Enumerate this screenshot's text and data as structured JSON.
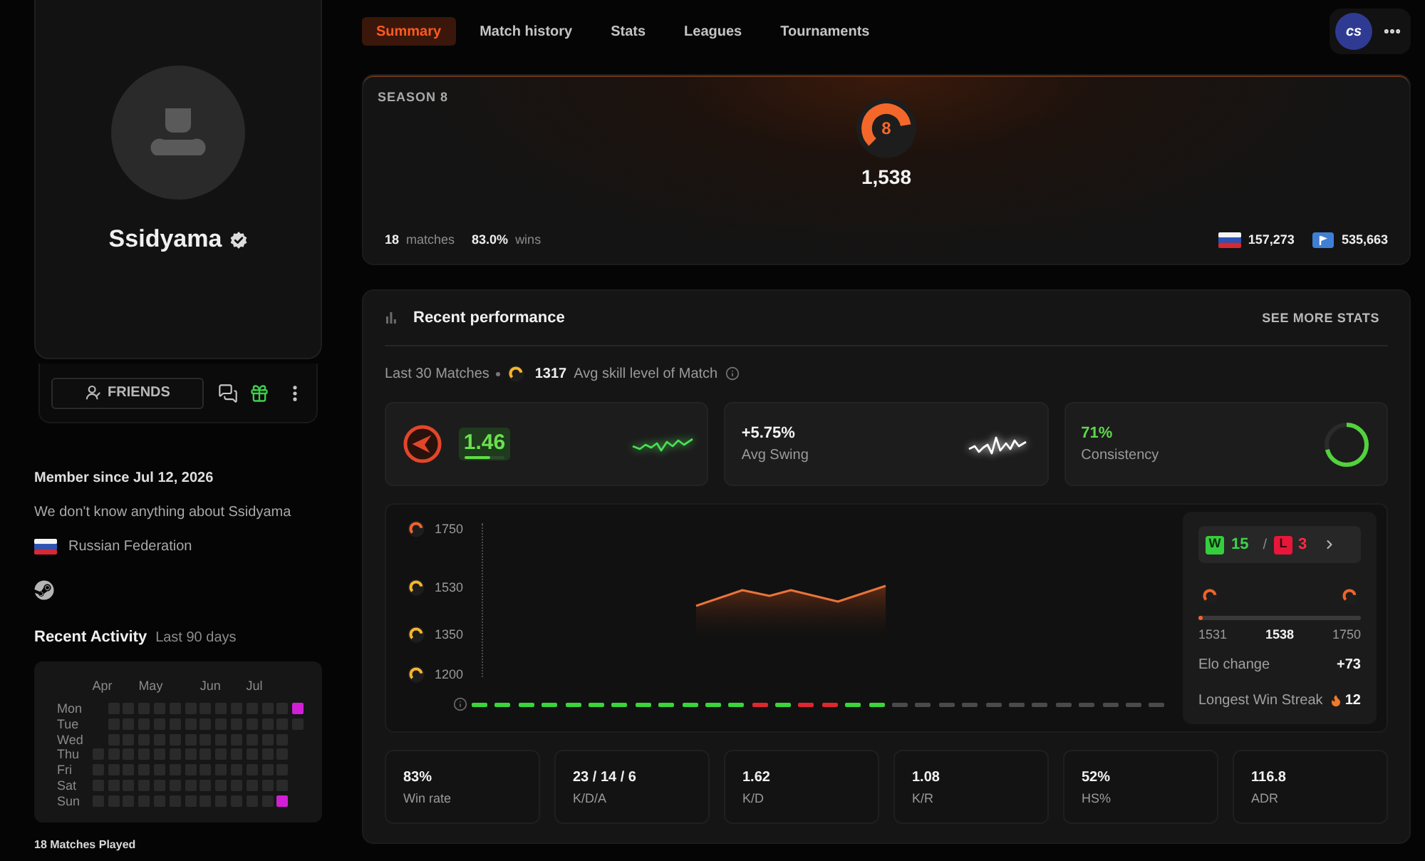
{
  "profile": {
    "name": "Ssidyama",
    "verified": true,
    "friends_button": "FRIENDS"
  },
  "about": {
    "member_since": "Member since Jul 12, 2026",
    "bio": "We don't know anything about Ssidyama",
    "country": "Russian Federation"
  },
  "recent_activity": {
    "title": "Recent Activity",
    "period": "Last 90 days",
    "days": [
      "Mon",
      "Tue",
      "Wed",
      "Thu",
      "Fri",
      "Sat",
      "Sun"
    ],
    "weeks": [
      {
        "kind": "tail",
        "month": "Apr",
        "cells": [
          {
            "played": false
          },
          {
            "played": false
          },
          {
            "played": false
          },
          {
            "played": false
          }
        ]
      },
      {
        "kind": "full",
        "cells": [
          {
            "played": false
          },
          {
            "played": false
          },
          {
            "played": false
          },
          {
            "played": false
          },
          {
            "played": false
          },
          {
            "played": false
          },
          {
            "played": false
          }
        ]
      },
      {
        "kind": "full",
        "cells": [
          {
            "played": false
          },
          {
            "played": false
          },
          {
            "played": false
          },
          {
            "played": false
          },
          {
            "played": false
          },
          {
            "played": false
          },
          {
            "played": false
          }
        ]
      },
      {
        "kind": "full",
        "month": "May",
        "cells": [
          {
            "played": false
          },
          {
            "played": false
          },
          {
            "played": false
          },
          {
            "played": false
          },
          {
            "played": false
          },
          {
            "played": false
          },
          {
            "played": false
          }
        ]
      },
      {
        "kind": "full",
        "cells": [
          {
            "played": false
          },
          {
            "played": false
          },
          {
            "played": false
          },
          {
            "played": false
          },
          {
            "played": false
          },
          {
            "played": false
          },
          {
            "played": false
          }
        ]
      },
      {
        "kind": "full",
        "cells": [
          {
            "played": false
          },
          {
            "played": false
          },
          {
            "played": false
          },
          {
            "played": false
          },
          {
            "played": false
          },
          {
            "played": false
          },
          {
            "played": false
          }
        ]
      },
      {
        "kind": "full",
        "cells": [
          {
            "played": false
          },
          {
            "played": false
          },
          {
            "played": false
          },
          {
            "played": false
          },
          {
            "played": false
          },
          {
            "played": false
          },
          {
            "played": false
          }
        ]
      },
      {
        "kind": "full",
        "month": "Jun",
        "cells": [
          {
            "played": false
          },
          {
            "played": false
          },
          {
            "played": false
          },
          {
            "played": false
          },
          {
            "played": false
          },
          {
            "played": false
          },
          {
            "played": false
          }
        ]
      },
      {
        "kind": "full",
        "cells": [
          {
            "played": false
          },
          {
            "played": false
          },
          {
            "played": false
          },
          {
            "played": false
          },
          {
            "played": false
          },
          {
            "played": false
          },
          {
            "played": false
          }
        ]
      },
      {
        "kind": "full",
        "cells": [
          {
            "played": false
          },
          {
            "played": false
          },
          {
            "played": false
          },
          {
            "played": false
          },
          {
            "played": false
          },
          {
            "played": false
          },
          {
            "played": false
          }
        ]
      },
      {
        "kind": "full",
        "month": "Jul",
        "cells": [
          {
            "played": false
          },
          {
            "played": false
          },
          {
            "played": false
          },
          {
            "played": false
          },
          {
            "played": false
          },
          {
            "played": false
          },
          {
            "played": false
          }
        ]
      },
      {
        "kind": "full",
        "cells": [
          {
            "played": false
          },
          {
            "played": false
          },
          {
            "played": false
          },
          {
            "played": false
          },
          {
            "played": false
          },
          {
            "played": false
          },
          {
            "played": false
          }
        ]
      },
      {
        "kind": "full",
        "cells": [
          {
            "played": false
          },
          {
            "played": false
          },
          {
            "played": false
          },
          {
            "played": false
          },
          {
            "played": false
          },
          {
            "played": false
          },
          {
            "played": true
          }
        ]
      },
      {
        "kind": "head",
        "cells": [
          {
            "played": true
          },
          {
            "played": false
          }
        ]
      }
    ],
    "footer": "18 Matches Played"
  },
  "tabs": [
    {
      "label": "Summary",
      "selected": true
    },
    {
      "label": "Match history",
      "selected": false
    },
    {
      "label": "Stats",
      "selected": false
    },
    {
      "label": "Leagues",
      "selected": false
    },
    {
      "label": "Tournaments",
      "selected": false
    }
  ],
  "game_badge": "cs",
  "season": {
    "title": "SEASON 8",
    "skill_level": "8",
    "elo": "1,538",
    "matches": "18",
    "matches_label": "matches",
    "wins": "83.0%",
    "wins_label": "wins",
    "country_rank": "157,273",
    "region_rank": "535,663"
  },
  "performance": {
    "title": "Recent performance",
    "link": "SEE MORE STATS",
    "scope": "Last 30 Matches",
    "avg_skill": "1317",
    "avg_skill_label": "Avg skill level of Match",
    "cards": [
      {
        "kind": "rating",
        "value": "1.46",
        "level": 0.65
      },
      {
        "kind": "swing",
        "value": "+5.75%",
        "label": "Avg Swing"
      },
      {
        "kind": "consistency",
        "value": "71%",
        "label": "Consistency",
        "level": 0.71
      }
    ],
    "elo_graph": {
      "y_labels": [
        {
          "label": "1750",
          "color": "#f0642a"
        },
        {
          "label": "1530",
          "color": "#f5b52e"
        },
        {
          "label": "1350",
          "color": "#f5b52e"
        },
        {
          "label": "1200",
          "color": "#f5b52e"
        }
      ]
    },
    "results": [
      {
        "kind": "win"
      },
      {
        "kind": "win"
      },
      {
        "kind": "win"
      },
      {
        "kind": "win"
      },
      {
        "kind": "win"
      },
      {
        "kind": "win"
      },
      {
        "kind": "win"
      },
      {
        "kind": "win"
      },
      {
        "kind": "win"
      },
      {
        "kind": "win"
      },
      {
        "kind": "win"
      },
      {
        "kind": "win"
      },
      {
        "kind": "loss"
      },
      {
        "kind": "win"
      },
      {
        "kind": "loss"
      },
      {
        "kind": "loss"
      },
      {
        "kind": "win"
      },
      {
        "kind": "win"
      },
      {
        "kind": "none"
      },
      {
        "kind": "none"
      },
      {
        "kind": "none"
      },
      {
        "kind": "none"
      },
      {
        "kind": "none"
      },
      {
        "kind": "none"
      },
      {
        "kind": "none"
      },
      {
        "kind": "none"
      },
      {
        "kind": "none"
      },
      {
        "kind": "none"
      },
      {
        "kind": "none"
      },
      {
        "kind": "none"
      }
    ],
    "summary": {
      "win_mark": "W",
      "wins": "15",
      "separator": "/",
      "loss_mark": "L",
      "losses": "3",
      "range_start": "1531",
      "current": "1538",
      "range_end": "1750",
      "level": 0.03,
      "elo_change_label": "Elo change",
      "elo_change": "+73",
      "streak_label": "Longest Win Streak",
      "streak": "12"
    },
    "stats": [
      {
        "value": "83%",
        "label": "Win rate"
      },
      {
        "value": "23 / 14 / 6",
        "label": "K/D/A"
      },
      {
        "value": "1.62",
        "label": "K/D"
      },
      {
        "value": "1.08",
        "label": "K/R"
      },
      {
        "value": "52%",
        "label": "HS%"
      },
      {
        "value": "116.8",
        "label": "ADR"
      }
    ]
  }
}
